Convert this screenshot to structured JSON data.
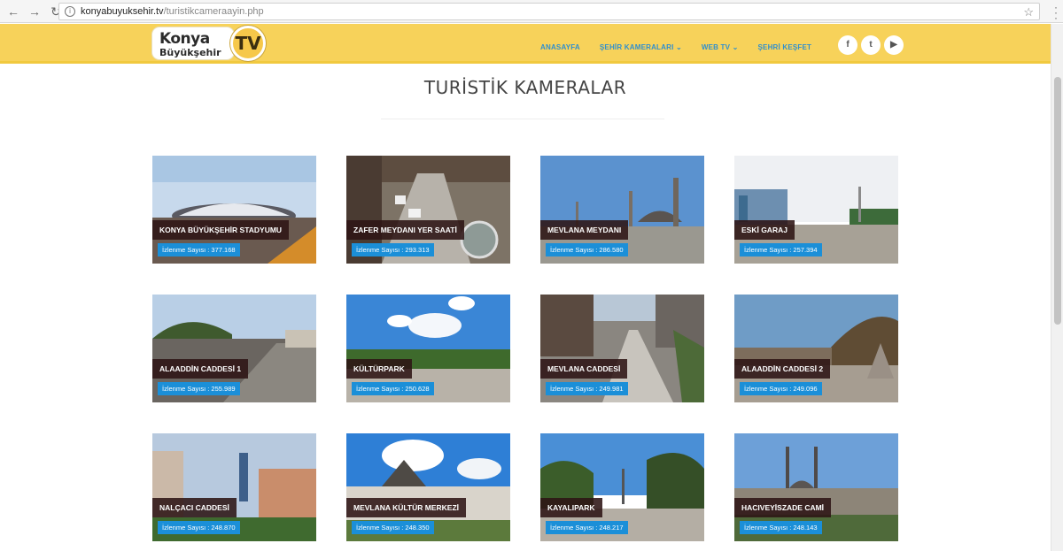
{
  "browser": {
    "back_icon": "←",
    "forward_icon": "→",
    "reload_icon": "↻",
    "url_host": "konyabuyuksehir.tv",
    "url_path": "/turistikcameraayin.php",
    "star_icon": "☆"
  },
  "header": {
    "logo_line1": "Konya",
    "logo_line2": "Büyükşehir",
    "logo_tv": "TV",
    "nav": [
      "ANASAYFA",
      "ŞEHİR KAMERALARI ⌄",
      "WEB TV ⌄",
      "ŞEHRİ KEŞFET"
    ],
    "socials": [
      "f",
      "t",
      "▶"
    ]
  },
  "page_title": "TURİSTİK KAMERALAR",
  "cameras": [
    {
      "name": "KONYA BÜYÜKŞEHİR STADYUMU",
      "views": "İzlenme Sayısı : 377.168"
    },
    {
      "name": "ZAFER MEYDANI YER SAATİ",
      "views": "İzlenme Sayısı : 293.313"
    },
    {
      "name": "MEVLANA MEYDANI",
      "views": "İzlenme Sayısı : 286.580"
    },
    {
      "name": "ESKİ GARAJ",
      "views": "İzlenme Sayısı : 257.394"
    },
    {
      "name": "ALAADDİN CADDESİ 1",
      "views": "İzlenme Sayısı : 255.989"
    },
    {
      "name": "KÜLTÜRPARK",
      "views": "İzlenme Sayısı : 250.628"
    },
    {
      "name": "MEVLANA CADDESİ",
      "views": "İzlenme Sayısı : 249.981"
    },
    {
      "name": "ALAADDİN CADDESİ 2",
      "views": "İzlenme Sayısı : 249.096"
    },
    {
      "name": "NALÇACI CADDESİ",
      "views": "İzlenme Sayısı : 248.870"
    },
    {
      "name": "MEVLANA KÜLTÜR MERKEZİ",
      "views": "İzlenme Sayısı : 248.350"
    },
    {
      "name": "KAYALIPARK",
      "views": "İzlenme Sayısı : 248.217"
    },
    {
      "name": "HACIVEYİSZADE CAMİ",
      "views": "İzlenme Sayısı : 248.143"
    }
  ]
}
